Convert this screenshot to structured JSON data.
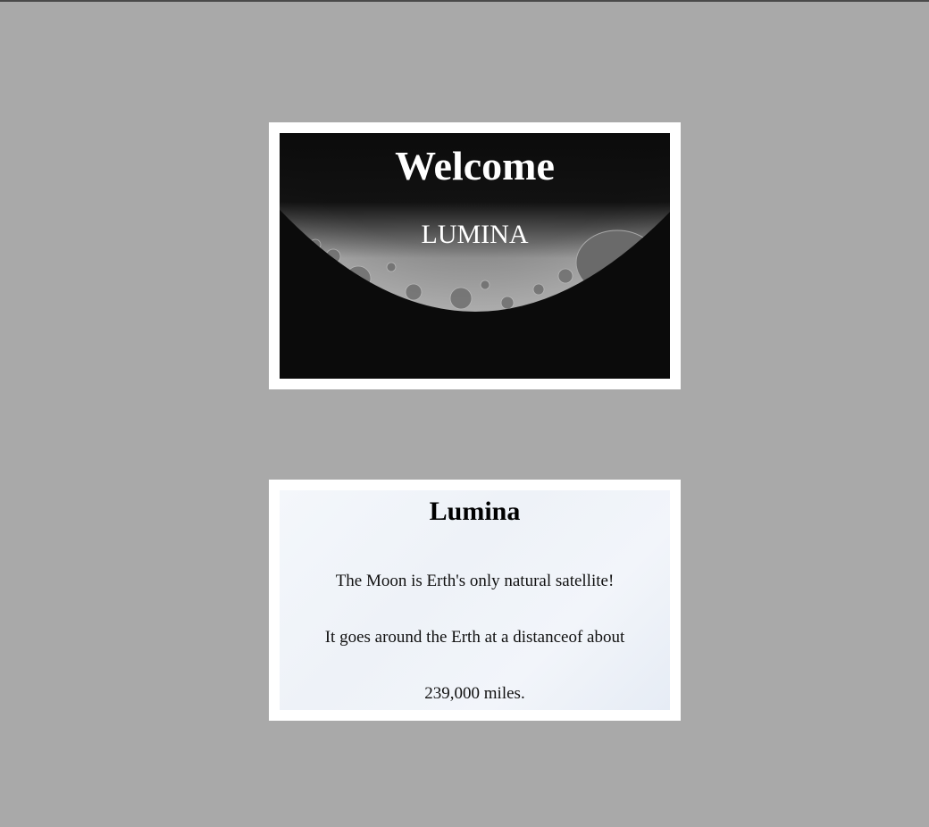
{
  "welcome_card": {
    "heading": "Welcome",
    "subheading": "LUMINA",
    "background_image": "moon-crescent-image"
  },
  "info_card": {
    "heading": "Lumina",
    "lines": [
      "The Moon is Erth's only natural satellite!",
      "It goes around the Erth at a distanceof about",
      "239,000 miles."
    ]
  },
  "colors": {
    "page_background": "#a9a9a9",
    "card_border": "#ffffff",
    "welcome_text": "#ffffff",
    "info_text": "#000000"
  }
}
